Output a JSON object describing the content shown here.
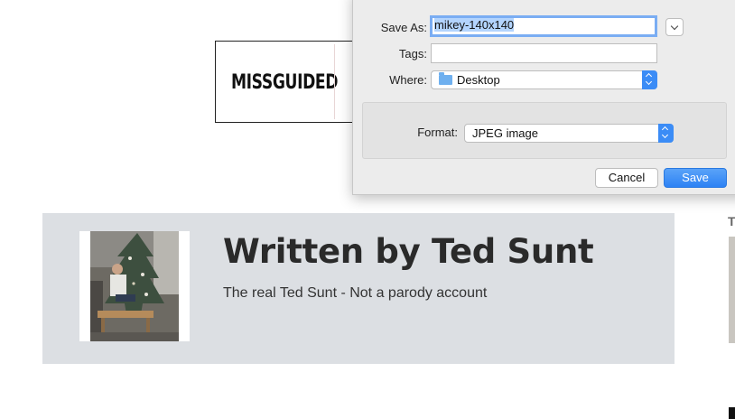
{
  "background": {
    "ad": {
      "brand_logo": "MISSGUIDED"
    },
    "author_card": {
      "name": "Written by Ted Sunt",
      "bio": "The real Ted Sunt - Not a parody account"
    },
    "sidebar_letter": "T"
  },
  "save_dialog": {
    "save_as": {
      "label": "Save As:",
      "value": "mikey-140x140"
    },
    "tags": {
      "label": "Tags:",
      "value": ""
    },
    "where": {
      "label": "Where:",
      "value": "Desktop"
    },
    "format": {
      "label": "Format:",
      "value": "JPEG image"
    },
    "cancel_label": "Cancel",
    "save_label": "Save"
  },
  "colors": {
    "accent": "#3b8cf6",
    "card_background": "#dcdfe3",
    "dialog_background": "#ececec"
  }
}
